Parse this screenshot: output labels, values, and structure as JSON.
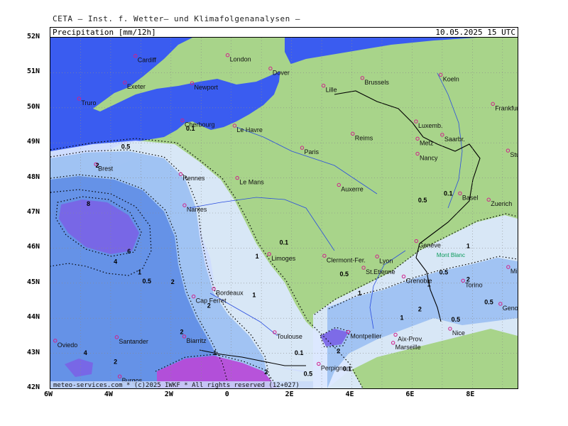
{
  "header": {
    "source": "CETA – Inst. f. Wetter– und Klimafolgenanalysen –"
  },
  "title_bar": {
    "parameter": "Precipitation [mm/12h]",
    "datetime": "10.05.2025  15 UTC"
  },
  "axes": {
    "lat_labels": [
      "52N",
      "51N",
      "50N",
      "49N",
      "48N",
      "47N",
      "46N",
      "45N",
      "44N",
      "43N",
      "42N"
    ],
    "lon_labels": [
      "6W",
      "4W",
      "2W",
      "0",
      "2E",
      "4E",
      "6E",
      "8E"
    ]
  },
  "colors": {
    "sea": "#3a5cf0",
    "land": "#a8d48a",
    "precip_light": "#dce8ff",
    "precip_medium": "#9cc0f2",
    "precip_heavy": "#5f8ee6",
    "precip_very_heavy": "#7a64e6",
    "precip_extreme": "#b84ad8"
  },
  "cities": [
    {
      "name": "Cardiff",
      "lon": -3.18,
      "lat": 51.48
    },
    {
      "name": "London",
      "lon": -0.12,
      "lat": 51.5
    },
    {
      "name": "Dover",
      "lon": 1.3,
      "lat": 51.12
    },
    {
      "name": "Exeter",
      "lon": -3.53,
      "lat": 50.72
    },
    {
      "name": "Newport",
      "lon": -1.3,
      "lat": 50.7
    },
    {
      "name": "Truro",
      "lon": -5.05,
      "lat": 50.26
    },
    {
      "name": "Lille",
      "lon": 3.06,
      "lat": 50.63
    },
    {
      "name": "Brussels",
      "lon": 4.35,
      "lat": 50.85
    },
    {
      "name": "Koeln",
      "lon": 6.95,
      "lat": 50.94
    },
    {
      "name": "Frankfurt",
      "lon": 8.68,
      "lat": 50.11
    },
    {
      "name": "Le Havre",
      "lon": 0.11,
      "lat": 49.49
    },
    {
      "name": "Cherbourg",
      "lon": -1.62,
      "lat": 49.64
    },
    {
      "name": "Luxemb.",
      "lon": 6.13,
      "lat": 49.61
    },
    {
      "name": "Reims",
      "lon": 4.03,
      "lat": 49.26
    },
    {
      "name": "Metz",
      "lon": 6.18,
      "lat": 49.12
    },
    {
      "name": "Saarbr.",
      "lon": 7.0,
      "lat": 49.23
    },
    {
      "name": "Paris",
      "lon": 2.35,
      "lat": 48.86
    },
    {
      "name": "Nancy",
      "lon": 6.18,
      "lat": 48.69
    },
    {
      "name": "Stuttgart",
      "lon": 9.18,
      "lat": 48.78
    },
    {
      "name": "Brest",
      "lon": -4.49,
      "lat": 48.39
    },
    {
      "name": "Rennes",
      "lon": -1.68,
      "lat": 48.11
    },
    {
      "name": "Le Mans",
      "lon": 0.2,
      "lat": 48.0
    },
    {
      "name": "Auxerre",
      "lon": 3.57,
      "lat": 47.8
    },
    {
      "name": "Nantes",
      "lon": -1.55,
      "lat": 47.22
    },
    {
      "name": "Basel",
      "lon": 7.59,
      "lat": 47.56
    },
    {
      "name": "Zuerich",
      "lon": 8.54,
      "lat": 47.38
    },
    {
      "name": "Geneve",
      "lon": 6.14,
      "lat": 46.2
    },
    {
      "name": "Limoges",
      "lon": 1.26,
      "lat": 45.83
    },
    {
      "name": "Clermont-Fer.",
      "lon": 3.09,
      "lat": 45.78
    },
    {
      "name": "Lyon",
      "lon": 4.84,
      "lat": 45.76
    },
    {
      "name": "St.Etienne",
      "lon": 4.39,
      "lat": 45.44
    },
    {
      "name": "Grenoble",
      "lon": 5.72,
      "lat": 45.19
    },
    {
      "name": "Milano",
      "lon": 9.19,
      "lat": 45.46
    },
    {
      "name": "Torino",
      "lon": 7.69,
      "lat": 45.07
    },
    {
      "name": "Bordeaux",
      "lon": -0.58,
      "lat": 44.84
    },
    {
      "name": "Cap Ferret",
      "lon": -1.25,
      "lat": 44.62
    },
    {
      "name": "Genova",
      "lon": 8.93,
      "lat": 44.41
    },
    {
      "name": "Montpellier",
      "lon": 3.88,
      "lat": 43.61
    },
    {
      "name": "Toulouse",
      "lon": 1.44,
      "lat": 43.6
    },
    {
      "name": "Nice",
      "lon": 7.26,
      "lat": 43.7
    },
    {
      "name": "Aix-Prov.",
      "lon": 5.45,
      "lat": 43.53
    },
    {
      "name": "Marseille",
      "lon": 5.37,
      "lat": 43.3
    },
    {
      "name": "Biarritz",
      "lon": -1.56,
      "lat": 43.48
    },
    {
      "name": "Oviedo",
      "lon": -5.84,
      "lat": 43.36
    },
    {
      "name": "Santander",
      "lon": -3.8,
      "lat": 43.46
    },
    {
      "name": "Perpignan",
      "lon": 2.9,
      "lat": 42.7
    },
    {
      "name": "Burgos",
      "lon": -3.7,
      "lat": 42.34
    }
  ],
  "mountain_label": {
    "name": "Mont Blanc",
    "lon": 6.86,
    "lat": 45.83
  },
  "contour_labels": [
    {
      "text": "8",
      "lon": -4.8,
      "lat": 47.2
    },
    {
      "text": "6",
      "lon": -3.45,
      "lat": 45.85
    },
    {
      "text": "4",
      "lon": -3.9,
      "lat": 45.55
    },
    {
      "text": "2",
      "lon": -4.5,
      "lat": 48.3
    },
    {
      "text": "0.5",
      "lon": -3.65,
      "lat": 48.83
    },
    {
      "text": "1",
      "lon": -3.1,
      "lat": 45.25
    },
    {
      "text": "0.5",
      "lon": -2.95,
      "lat": 45.0
    },
    {
      "text": "2",
      "lon": -2.0,
      "lat": 44.98
    },
    {
      "text": "2",
      "lon": -0.8,
      "lat": 44.3
    },
    {
      "text": "0.1",
      "lon": 1.6,
      "lat": 46.1
    },
    {
      "text": "1",
      "lon": 0.8,
      "lat": 45.7
    },
    {
      "text": "1",
      "lon": 0.7,
      "lat": 44.6
    },
    {
      "text": "0.5",
      "lon": 3.6,
      "lat": 45.2
    },
    {
      "text": "1",
      "lon": 4.2,
      "lat": 44.65
    },
    {
      "text": "0.1",
      "lon": 2.1,
      "lat": 42.95
    },
    {
      "text": "2",
      "lon": 3.5,
      "lat": 43.0
    },
    {
      "text": "0.5",
      "lon": 2.4,
      "lat": 42.35
    },
    {
      "text": "0.1",
      "lon": 3.7,
      "lat": 42.5
    },
    {
      "text": "2",
      "lon": 1.1,
      "lat": 42.4
    },
    {
      "text": "2",
      "lon": -1.7,
      "lat": 43.55
    },
    {
      "text": "2",
      "lon": -3.9,
      "lat": 42.7
    },
    {
      "text": "4",
      "lon": -4.9,
      "lat": 42.95
    },
    {
      "text": "1",
      "lon": -0.6,
      "lat": 42.95
    },
    {
      "text": "0.1",
      "lon": -1.5,
      "lat": 49.35
    },
    {
      "text": "0.5",
      "lon": 6.2,
      "lat": 47.3
    },
    {
      "text": "0.1",
      "lon": 7.05,
      "lat": 47.5
    },
    {
      "text": "0.5",
      "lon": 6.9,
      "lat": 45.25
    },
    {
      "text": "2",
      "lon": 7.8,
      "lat": 45.05
    },
    {
      "text": "2",
      "lon": 6.2,
      "lat": 44.2
    },
    {
      "text": "0.5",
      "lon": 7.3,
      "lat": 43.9
    },
    {
      "text": "1",
      "lon": 5.6,
      "lat": 43.95
    },
    {
      "text": "1",
      "lon": 7.8,
      "lat": 46.0
    },
    {
      "text": "0.5",
      "lon": 8.4,
      "lat": 44.4
    },
    {
      "text": "1",
      "lon": 6.5,
      "lat": 44.9
    }
  ],
  "footer": {
    "copyright": "meteo-services.com * (c)2025 IWKF * All rights reserved (12+027)"
  }
}
